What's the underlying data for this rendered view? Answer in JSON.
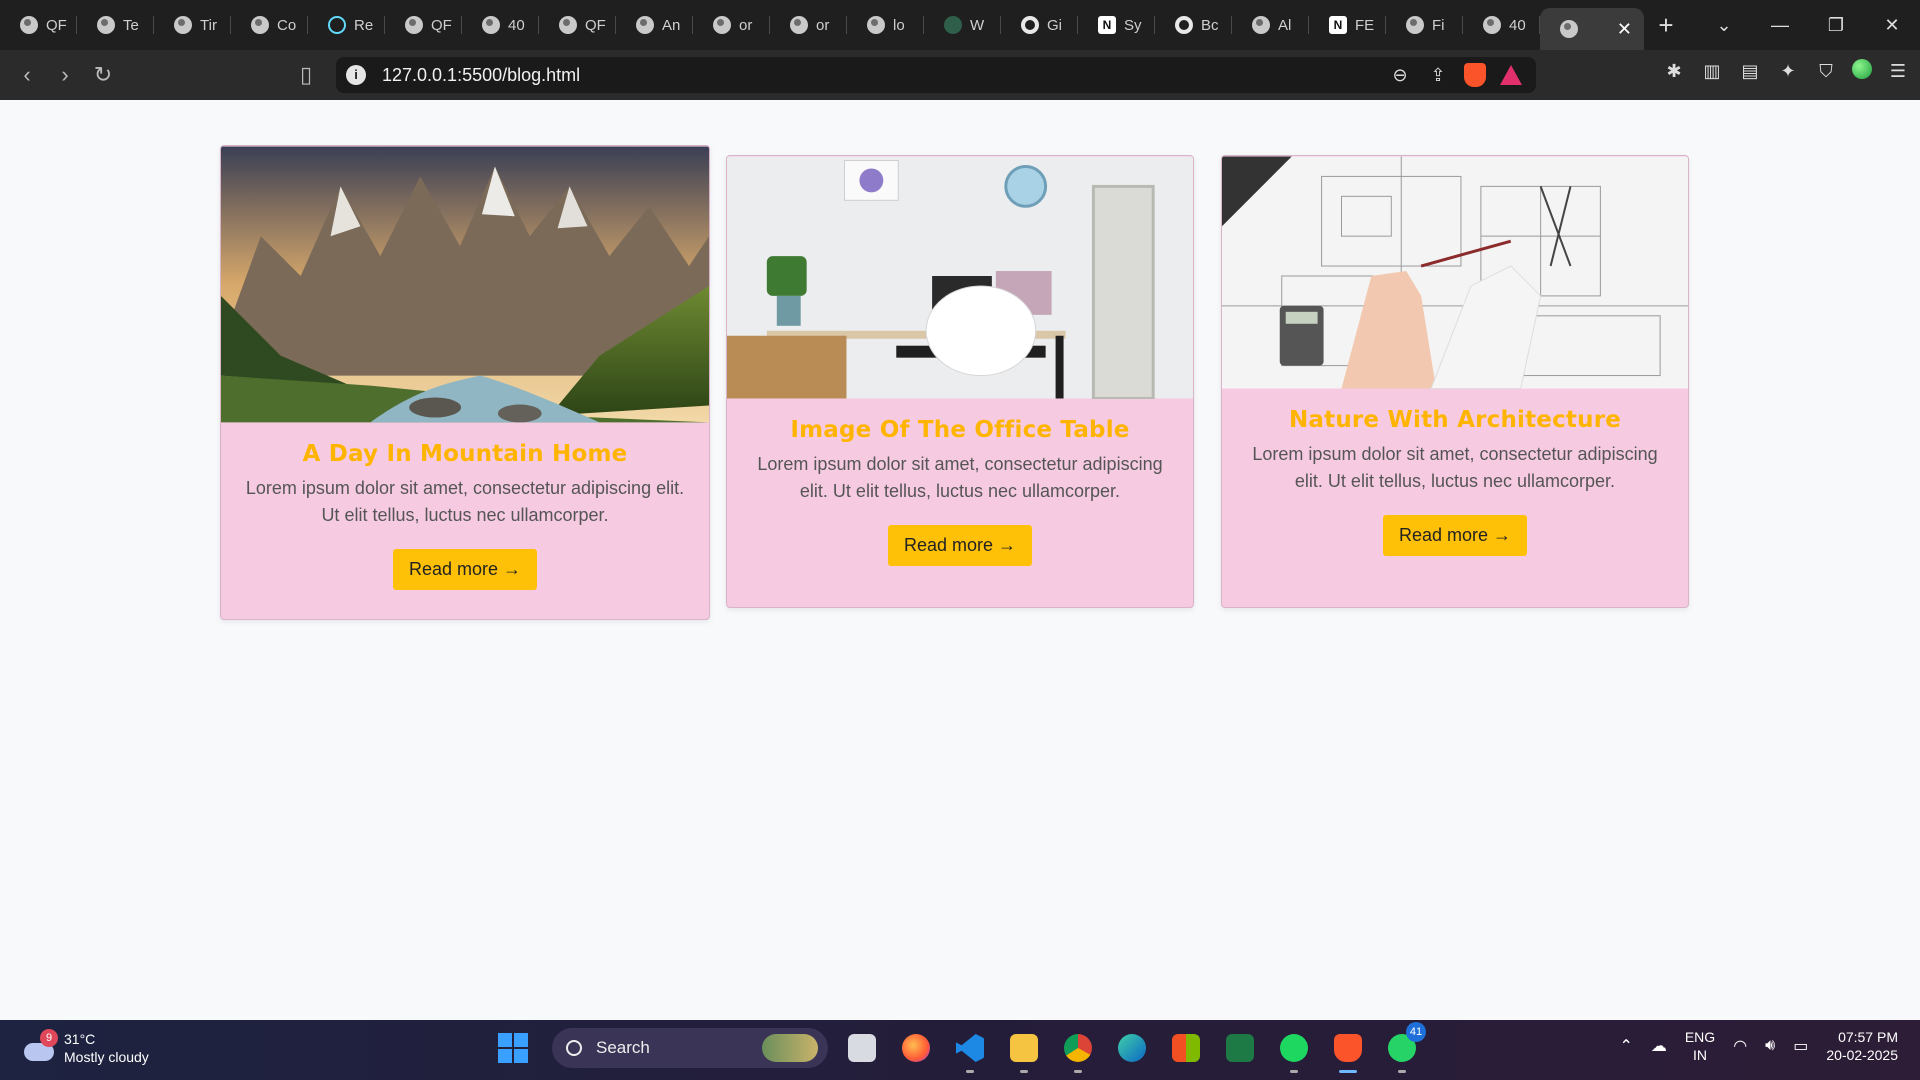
{
  "browser": {
    "tabs": [
      {
        "title": "QF",
        "icon": "globe-icon"
      },
      {
        "title": "Te",
        "icon": "globe-icon"
      },
      {
        "title": "Tir",
        "icon": "globe-icon"
      },
      {
        "title": "Co",
        "icon": "globe-icon"
      },
      {
        "title": "Re",
        "icon": "react-icon"
      },
      {
        "title": "QF",
        "icon": "globe-icon"
      },
      {
        "title": "40",
        "icon": "globe-icon"
      },
      {
        "title": "QF",
        "icon": "globe-icon"
      },
      {
        "title": "An",
        "icon": "globe-icon"
      },
      {
        "title": "or",
        "icon": "globe-icon"
      },
      {
        "title": "or",
        "icon": "globe-icon"
      },
      {
        "title": "lo",
        "icon": "globe-icon"
      },
      {
        "title": "W",
        "icon": "w-icon"
      },
      {
        "title": "Gi",
        "icon": "github-icon"
      },
      {
        "title": "Sy",
        "icon": "notion-icon"
      },
      {
        "title": "Bc",
        "icon": "github-icon"
      },
      {
        "title": "Al",
        "icon": "globe-icon"
      },
      {
        "title": "FE",
        "icon": "notion-icon"
      },
      {
        "title": "Fi",
        "icon": "globe-icon"
      },
      {
        "title": "40",
        "icon": "globe-icon"
      }
    ],
    "new_tab_label": "+",
    "url": "127.0.0.1:5500/blog.html",
    "accent_color": "#fb542b"
  },
  "cards": [
    {
      "title": "A Day In Mountain Home",
      "text": "Lorem ipsum dolor sit amet, consectetur adipiscing elit. Ut elit tellus, luctus nec ullamcorper.",
      "button": "Read more →",
      "image": "mountain-landscape-image"
    },
    {
      "title": "Image Of The Office Table",
      "text": "Lorem ipsum dolor sit amet, consectetur adipiscing elit. Ut elit tellus, luctus nec ullamcorper.",
      "button": "Read more →",
      "image": "office-desk-image"
    },
    {
      "title": "Nature With Architecture",
      "text": "Lorem ipsum dolor sit amet, consectetur adipiscing elit. Ut elit tellus, luctus nec ullamcorper.",
      "button": "Read more →",
      "image": "architecture-blueprint-image"
    }
  ],
  "colors": {
    "card_background": "#f6cbe2",
    "title_color": "#ffb400",
    "button_color": "#ffc107"
  },
  "taskbar": {
    "weather": {
      "temp": "31°C",
      "condition": "Mostly cloudy",
      "badge": "9"
    },
    "search_placeholder": "Search",
    "apps": [
      "file-explorer-icon",
      "firefox-icon",
      "vscode-icon",
      "folder-icon",
      "chrome-icon",
      "edge-icon",
      "store-icon",
      "excel-icon",
      "spotify-icon",
      "brave-icon",
      "whatsapp-icon"
    ],
    "whatsapp_badge": "41",
    "lang_top": "ENG",
    "lang_bottom": "IN",
    "time": "07:57 PM",
    "date": "20-02-2025"
  }
}
